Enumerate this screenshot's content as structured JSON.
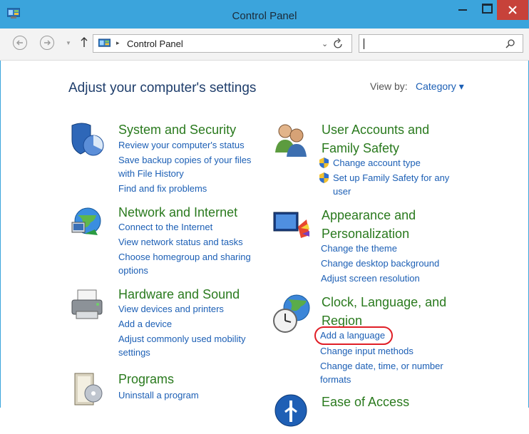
{
  "window": {
    "title": "Control Panel",
    "app_icon": "control-panel-icon"
  },
  "titlebar_buttons": {
    "minimize": "minimize-icon",
    "maximize": "maximize-icon",
    "close": "close-icon"
  },
  "nav": {
    "back": "back-arrow-icon",
    "forward": "forward-arrow-icon",
    "recent": "dropdown-icon",
    "up": "up-arrow-icon"
  },
  "address": {
    "crumb_sep": "▸",
    "crumb": "Control Panel",
    "refresh": "refresh-icon",
    "dropdown": "chevron-down-icon"
  },
  "search": {
    "value": "",
    "placeholder": ""
  },
  "main": {
    "heading": "Adjust your computer's settings",
    "view_by_label": "View by:",
    "view_by_value": "Category ▾"
  },
  "categories": [
    {
      "name": "System and Security",
      "links": [
        "Review your computer's status",
        "Save backup copies of your files",
        "with File History",
        "Find and fix problems"
      ]
    },
    {
      "name": "Network and Internet",
      "links": [
        "Connect to the Internet",
        "View network status and tasks",
        "Choose homegroup and sharing",
        "options"
      ]
    },
    {
      "name": "Hardware and Sound",
      "links": [
        "View devices and printers",
        "Add a device",
        "Adjust commonly used mobility",
        "settings"
      ]
    },
    {
      "name": "Programs",
      "links": [
        "Uninstall a program"
      ]
    },
    {
      "name_lines": [
        "User Accounts and",
        "Family Safety"
      ],
      "links": [
        "Change account type",
        "Set up Family Safety for any",
        "user"
      ]
    },
    {
      "name_lines": [
        "Appearance and",
        "Personalization"
      ],
      "links": [
        "Change the theme",
        "Change desktop background",
        "Adjust screen resolution"
      ]
    },
    {
      "name_lines": [
        "Clock, Language, and",
        "Region"
      ],
      "links": [
        "Add a language",
        "Change input methods",
        "Change date, time, or number",
        "formats"
      ]
    },
    {
      "name": "Ease of Access"
    }
  ],
  "colors": {
    "titlebar": "#3ba4dc",
    "close": "#c7423a",
    "category": "#2a7a1e",
    "link": "#1c5fb5",
    "heading": "#1e3d6b",
    "highlight": "#e01e26"
  }
}
